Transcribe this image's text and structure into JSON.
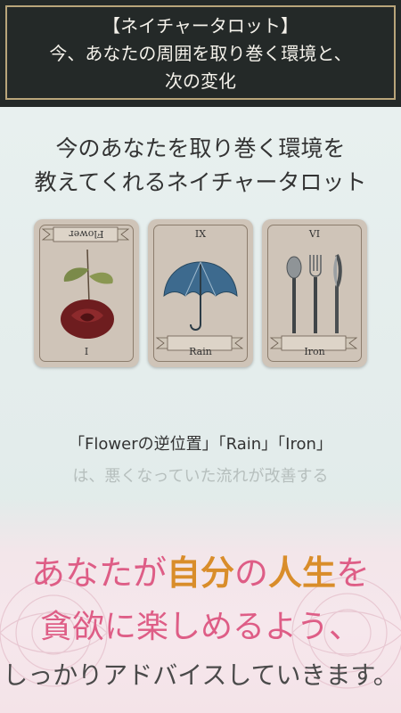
{
  "header": {
    "line1": "【ネイチャータロット】",
    "line2": "今、あなたの周囲を取り巻く環境と、",
    "line3": "次の変化"
  },
  "intro": {
    "line1": "今のあなたを取り巻く環境を",
    "line2": "教えてくれるネイチャータロット"
  },
  "cards": [
    {
      "top": "Flower",
      "bottom": "I",
      "icon": "rose-icon"
    },
    {
      "top": "IX",
      "bottom": "Rain",
      "icon": "umbrella-icon"
    },
    {
      "top": "VI",
      "bottom": "Iron",
      "icon": "cutlery-icon"
    }
  ],
  "description": {
    "line1": "「Flowerの逆位置」「Rain」「Iron」",
    "line2": "は、悪くなっていた流れが改善する"
  },
  "promo": {
    "l1a": "あなたが",
    "l1b": "自分",
    "l1c": "の",
    "l1d": "人生",
    "l1e": "を",
    "l2": "貪欲に楽しめるよう、",
    "l3": "しっかりアドバイスしていきます。"
  },
  "colors": {
    "header_bg": "#242928",
    "frame": "#b9a57a",
    "pink": "#de5d86",
    "gold": "#d98d2a"
  }
}
